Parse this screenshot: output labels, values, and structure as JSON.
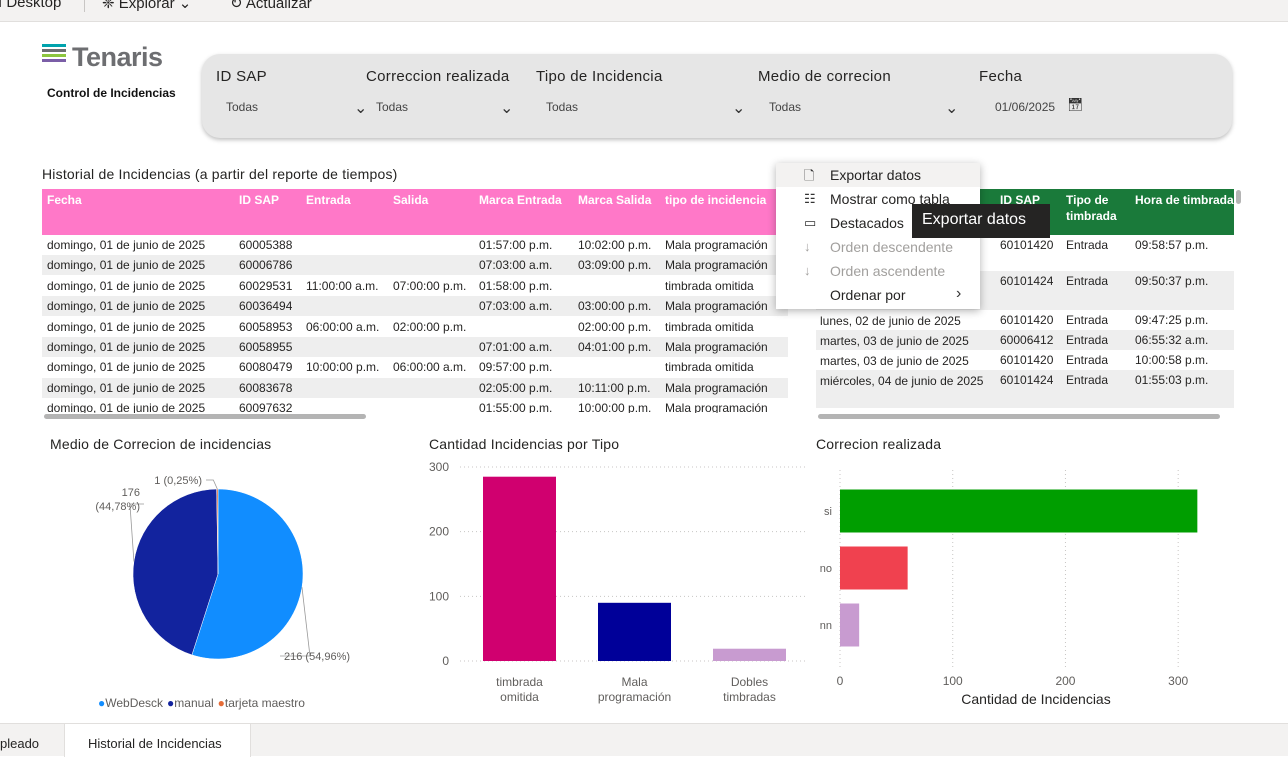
{
  "topbar": {
    "app": "I Desktop",
    "explore": "Explorar",
    "refresh": "Actualizar"
  },
  "logo": {
    "name": "Tenaris",
    "subtitle": "Control de Incidencias"
  },
  "slicers": [
    {
      "label": "ID SAP",
      "value": "Todas"
    },
    {
      "label": "Correccion realizada",
      "value": "Todas"
    },
    {
      "label": "Tipo de Incidencia",
      "value": "Todas"
    },
    {
      "label": "Medio de correcion",
      "value": "Todas"
    },
    {
      "label": "Fecha",
      "value": "01/06/2025"
    }
  ],
  "historial": {
    "title": "Historial de Incidencias (a partir del reporte de tiempos)",
    "columns": [
      "Fecha",
      "ID SAP",
      "Entrada",
      "Salida",
      "Marca Entrada",
      "Marca Salida",
      "tipo de incidencia"
    ],
    "rows": [
      [
        "domingo, 01 de junio de 2025",
        "60005388",
        "",
        "",
        "01:57:00 p.m.",
        "10:02:00 p.m.",
        "Mala programación"
      ],
      [
        "domingo, 01 de junio de 2025",
        "60006786",
        "",
        "",
        "07:03:00 a.m.",
        "03:09:00 p.m.",
        "Mala programación"
      ],
      [
        "domingo, 01 de junio de 2025",
        "60029531",
        "11:00:00 a.m.",
        "07:00:00 p.m.",
        "01:58:00 p.m.",
        "",
        "timbrada omitida"
      ],
      [
        "domingo, 01 de junio de 2025",
        "60036494",
        "",
        "",
        "07:03:00 a.m.",
        "03:00:00 p.m.",
        "Mala programación"
      ],
      [
        "domingo, 01 de junio de 2025",
        "60058953",
        "06:00:00 a.m.",
        "02:00:00 p.m.",
        "",
        "02:00:00 p.m.",
        "timbrada omitida"
      ],
      [
        "domingo, 01 de junio de 2025",
        "60058955",
        "",
        "",
        "07:01:00 a.m.",
        "04:01:00 p.m.",
        "Mala programación"
      ],
      [
        "domingo, 01 de junio de 2025",
        "60080479",
        "10:00:00 p.m.",
        "06:00:00 a.m.",
        "09:57:00 p.m.",
        "",
        "timbrada omitida"
      ],
      [
        "domingo, 01 de junio de 2025",
        "60083678",
        "",
        "",
        "02:05:00 p.m.",
        "10:11:00 p.m.",
        "Mala programación"
      ],
      [
        "domingo, 01 de junio de 2025",
        "60097632",
        "",
        "",
        "01:55:00 p.m.",
        "10:00:00 p.m.",
        "Mala programación"
      ]
    ]
  },
  "timbradas": {
    "columns": [
      "ID SAP",
      "Tipo de timbrada",
      "Hora de timbrada"
    ],
    "rows": [
      [
        "",
        "60101420",
        "Entrada",
        "09:58:57 p.m."
      ],
      [
        "",
        "60101424",
        "Entrada",
        "09:50:37 p.m."
      ],
      [
        "lunes, 02 de junio de 2025",
        "60101420",
        "Entrada",
        "09:47:25 p.m."
      ],
      [
        "martes, 03 de junio de 2025",
        "60006412",
        "Entrada",
        "06:55:32 a.m."
      ],
      [
        "martes, 03 de junio de 2025",
        "60101420",
        "Entrada",
        "10:00:58 p.m."
      ],
      [
        "miércoles, 04 de junio de 2025",
        "60101424",
        "Entrada",
        "01:55:03 p.m."
      ]
    ]
  },
  "context_menu": {
    "items": [
      {
        "icon": "export-icon",
        "label": "Exportar datos",
        "disabled": false
      },
      {
        "icon": "table-icon",
        "label": "Mostrar como tabla",
        "disabled": false
      },
      {
        "icon": "spotlight-icon",
        "label": "Destacados",
        "disabled": false
      },
      {
        "icon": "sort-desc-icon",
        "label": "Orden descendente",
        "disabled": true
      },
      {
        "icon": "sort-asc-icon",
        "label": "Orden ascendente",
        "disabled": true
      },
      {
        "icon": "",
        "label": "Ordenar por",
        "disabled": false
      }
    ],
    "tooltip": "Exportar datos"
  },
  "pie_chart_title": "Medio de Correcion de incidencias",
  "bar_chart_title": "Cantidad Incidencias por Tipo",
  "hbar_chart_title": "Correcion realizada",
  "chart_data": [
    {
      "type": "pie",
      "title": "Medio de Correcion de incidencias",
      "labels": [
        "WebDesck",
        "manual",
        "tarjeta maestro"
      ],
      "values": [
        216,
        176,
        1
      ],
      "data_labels": [
        "216 (54,96%)",
        "176 (44,78%)",
        "1 (0,25%)"
      ],
      "colors": [
        "#118dff",
        "#12239e",
        "#e66c37"
      ],
      "legend": "bottom"
    },
    {
      "type": "bar",
      "title": "Cantidad Incidencias por Tipo",
      "categories": [
        "timbrada omitida",
        "Mala programación",
        "Dobles timbradas"
      ],
      "values": [
        285,
        90,
        19
      ],
      "colors": [
        "#d0006f",
        "#000099",
        "#c89bd0"
      ],
      "yticks": [
        0,
        100,
        200,
        300
      ],
      "ylim": [
        0,
        300
      ]
    },
    {
      "type": "bar",
      "orientation": "horizontal",
      "title": "Correcion realizada",
      "categories": [
        "si",
        "no",
        "nn"
      ],
      "values": [
        317,
        60,
        17
      ],
      "colors": [
        "#009e00",
        "#f0414f",
        "#c89bd0"
      ],
      "xticks": [
        0,
        100,
        200,
        300
      ],
      "xlabel": "Cantidad de Incidencias",
      "xlim": [
        0,
        330
      ]
    }
  ],
  "bottom": {
    "tab1": "pleado",
    "tab2": "Historial de Incidencias"
  },
  "colors": {
    "pink_header": "#ff78c8",
    "green_header": "#1a7a3a"
  }
}
